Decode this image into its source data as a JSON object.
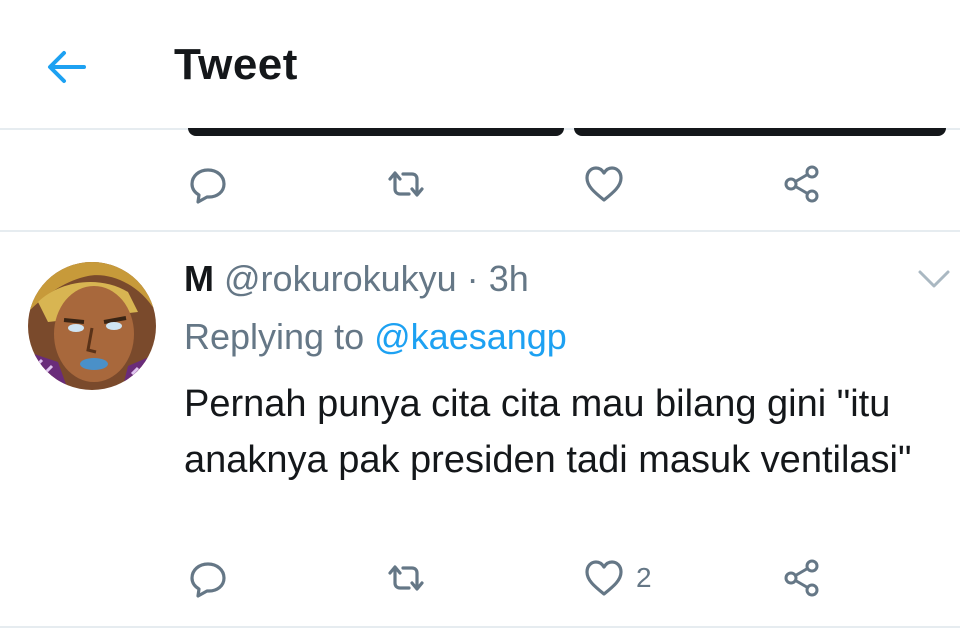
{
  "header": {
    "title": "Tweet",
    "back_icon": "arrow-left-icon",
    "accent": "#1da1f2"
  },
  "top_actions": {
    "reply_icon": "reply-icon",
    "retweet_icon": "retweet-icon",
    "like_icon": "heart-icon",
    "share_icon": "share-icon"
  },
  "tweet": {
    "name": "M",
    "handle": "@rokurokukyu",
    "separator": "·",
    "time": "3h",
    "replying_prefix": "Replying to",
    "replying_to": "@kaesangp",
    "text": "Pernah punya cita cita mau bilang gini \"itu anaknya pak presiden tadi masuk ventilasi\"",
    "more_icon": "chevron-down-icon",
    "likes": "2"
  },
  "colors": {
    "text_primary": "#14171a",
    "text_secondary": "#657786",
    "link": "#1da1f2",
    "divider": "#e6ecf0"
  }
}
